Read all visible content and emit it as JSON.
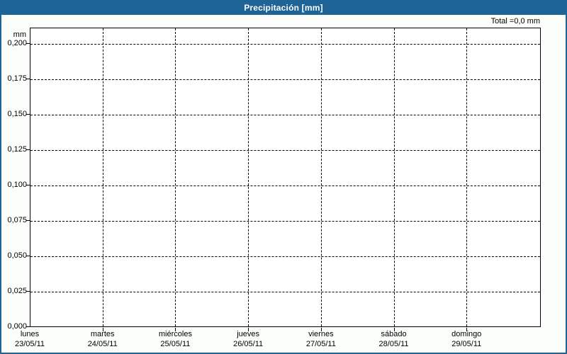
{
  "header": {
    "title": "Precipitación [mm]"
  },
  "summary": {
    "total_label": "Total =0,0 mm"
  },
  "y_axis": {
    "unit": "mm",
    "ticks": [
      {
        "label": "0,000",
        "value": 0
      },
      {
        "label": "0,025",
        "value": 0.025
      },
      {
        "label": "0,050",
        "value": 0.05
      },
      {
        "label": "0,075",
        "value": 0.075
      },
      {
        "label": "0,100",
        "value": 0.1
      },
      {
        "label": "0,125",
        "value": 0.125
      },
      {
        "label": "0,150",
        "value": 0.15
      },
      {
        "label": "0,175",
        "value": 0.175
      },
      {
        "label": "0,200",
        "value": 0.2
      }
    ]
  },
  "x_axis": {
    "days": [
      {
        "name": "lunes",
        "date": "23/05/11"
      },
      {
        "name": "martes",
        "date": "24/05/11"
      },
      {
        "name": "miércoles",
        "date": "25/05/11"
      },
      {
        "name": "jueves",
        "date": "26/05/11"
      },
      {
        "name": "viernes",
        "date": "27/05/11"
      },
      {
        "name": "sábado",
        "date": "28/05/11"
      },
      {
        "name": "domingo",
        "date": "29/05/11"
      }
    ]
  },
  "chart_data": {
    "type": "bar",
    "title": "Precipitación [mm]",
    "xlabel": "",
    "ylabel": "mm",
    "ylim": [
      0,
      0.2
    ],
    "ytick_step": 0.025,
    "categories": [
      "lunes 23/05/11",
      "martes 24/05/11",
      "miércoles 25/05/11",
      "jueves 26/05/11",
      "viernes 27/05/11",
      "sábado 28/05/11",
      "domingo 29/05/11"
    ],
    "values": [
      0,
      0,
      0,
      0,
      0,
      0,
      0
    ],
    "total_text": "Total =0,0 mm",
    "grid": "dashed-both-axes",
    "legend": "none"
  },
  "colors": {
    "header_bg": "#1e6497",
    "frame_border": "#1e6497",
    "title_text": "#ffffff",
    "grid": "#000000",
    "axis": "#000000",
    "text": "#000000",
    "window_bg": "#fcfefc",
    "plot_bg": "#ffffff"
  }
}
